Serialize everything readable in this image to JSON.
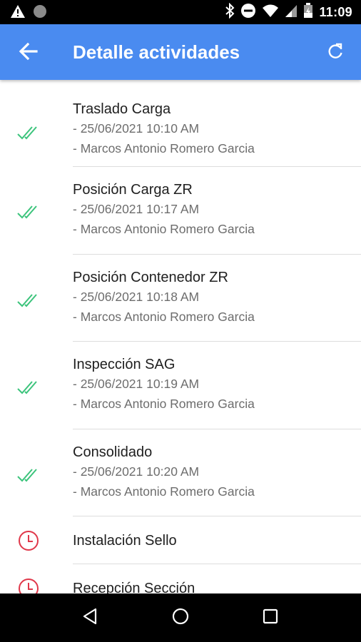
{
  "status_bar": {
    "time": "11:09",
    "icons": [
      "warning-icon",
      "circle-icon",
      "bluetooth-icon",
      "do-not-disturb-icon",
      "wifi-icon",
      "signal-icon",
      "battery-icon"
    ]
  },
  "app_bar": {
    "title": "Detalle actividades",
    "back_icon": "arrow-left-icon",
    "refresh_icon": "refresh-icon",
    "color": "#4a8bf0"
  },
  "activities": [
    {
      "name": "Traslado Carga",
      "date": "- 25/06/2021 10:10 AM",
      "user": "- Marcos Antonio Romero Garcia",
      "status": "done"
    },
    {
      "name": "Posición Carga ZR",
      "date": "- 25/06/2021 10:17 AM",
      "user": "- Marcos Antonio Romero Garcia",
      "status": "done"
    },
    {
      "name": "Posición Contenedor ZR",
      "date": "- 25/06/2021 10:18 AM",
      "user": "- Marcos Antonio Romero Garcia",
      "status": "done"
    },
    {
      "name": "Inspección SAG",
      "date": "- 25/06/2021 10:19 AM",
      "user": "- Marcos Antonio Romero Garcia",
      "status": "done"
    },
    {
      "name": "Consolidado",
      "date": "- 25/06/2021 10:20 AM",
      "user": "- Marcos Antonio Romero Garcia",
      "status": "done"
    },
    {
      "name": "Instalación Sello",
      "status": "pending"
    },
    {
      "name": "Recepción Sección",
      "status": "pending"
    }
  ],
  "colors": {
    "done": "#3cc47c",
    "pending": "#e0384a"
  },
  "nav_bar": {
    "icons": [
      "back-triangle-icon",
      "home-circle-icon",
      "recents-square-icon"
    ]
  }
}
